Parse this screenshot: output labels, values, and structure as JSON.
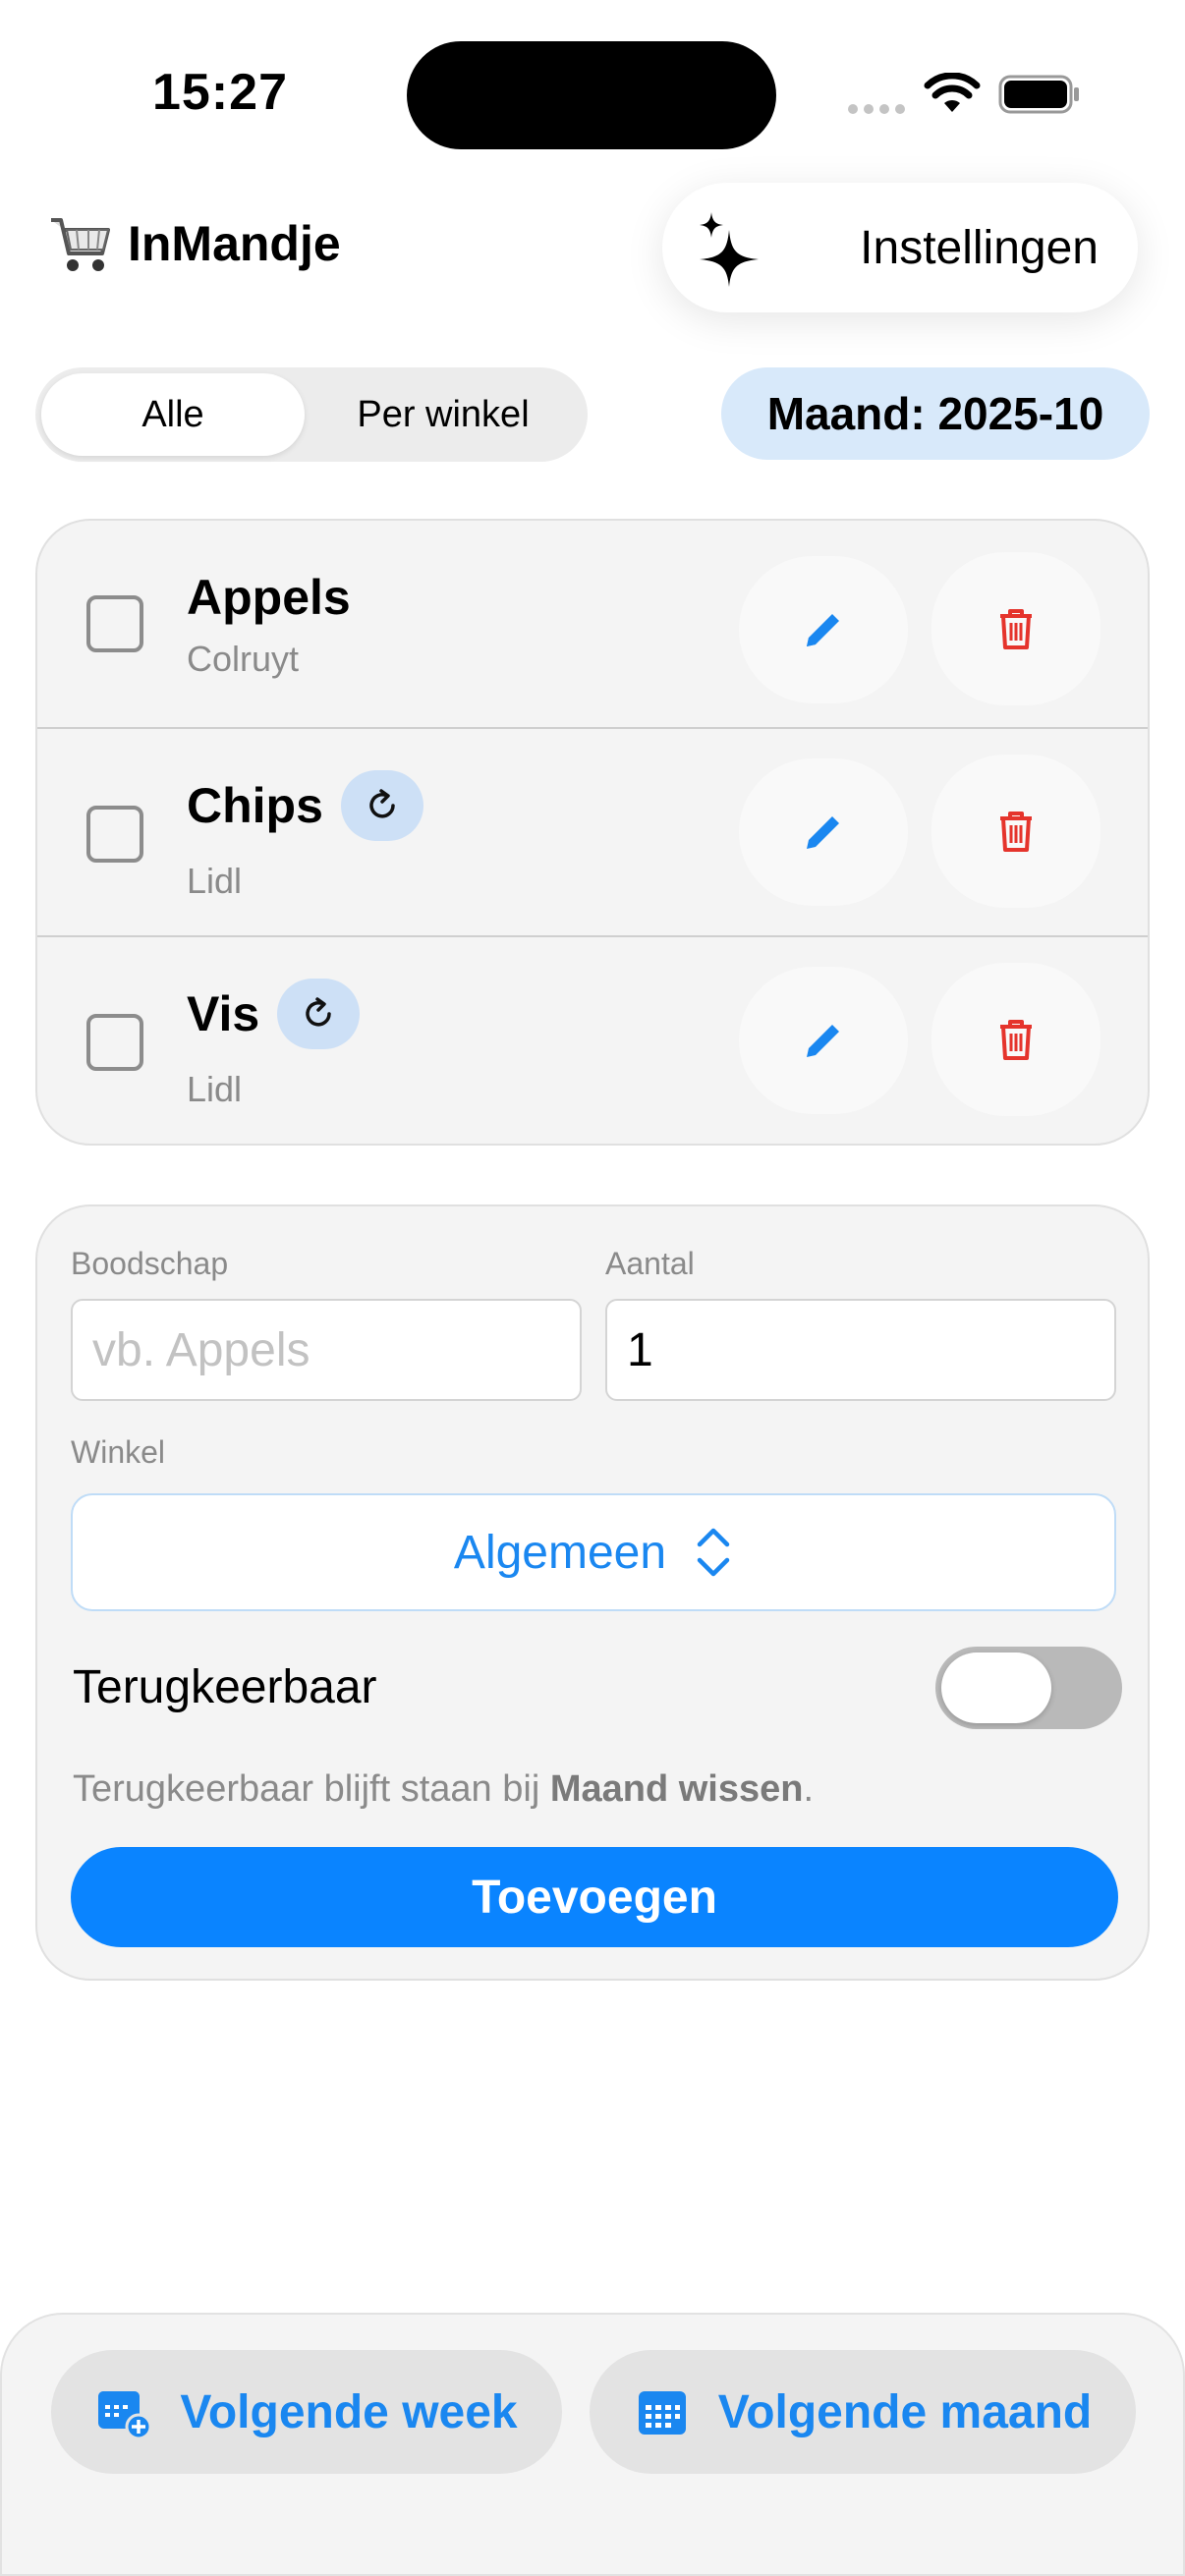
{
  "status": {
    "time": "15:27"
  },
  "header": {
    "title": "InMandje",
    "settings_label": "Instellingen"
  },
  "filter": {
    "tabs": [
      "Alle",
      "Per winkel"
    ],
    "selected": "Alle",
    "month_label": "Maand: 2025-10"
  },
  "items": [
    {
      "name": "Appels",
      "store": "Colruyt",
      "recurring": false,
      "checked": false
    },
    {
      "name": "Chips",
      "store": "Lidl",
      "recurring": true,
      "checked": false
    },
    {
      "name": "Vis",
      "store": "Lidl",
      "recurring": true,
      "checked": false
    }
  ],
  "form": {
    "item_label": "Boodschap",
    "item_placeholder": "vb. Appels",
    "item_value": "",
    "qty_label": "Aantal",
    "qty_value": "1",
    "store_label": "Winkel",
    "store_value": "Algemeen",
    "recurring_label": "Terugkeerbaar",
    "recurring_on": false,
    "hint_prefix": "Terugkeerbaar blijft staan bij ",
    "hint_bold": "Maand wissen",
    "hint_suffix": ".",
    "add_label": "Toevoegen"
  },
  "bottom": {
    "next_week": "Volgende week",
    "next_month": "Volgende maand"
  },
  "colors": {
    "accent": "#0a84ff",
    "delete": "#e5342c",
    "month_bg": "#d8e9fa"
  },
  "icons": [
    "cart-icon",
    "sparkles-icon",
    "pencil-icon",
    "trash-icon",
    "repeat-icon",
    "chevron-updown-icon",
    "calendar-plus-icon",
    "calendar-icon"
  ]
}
